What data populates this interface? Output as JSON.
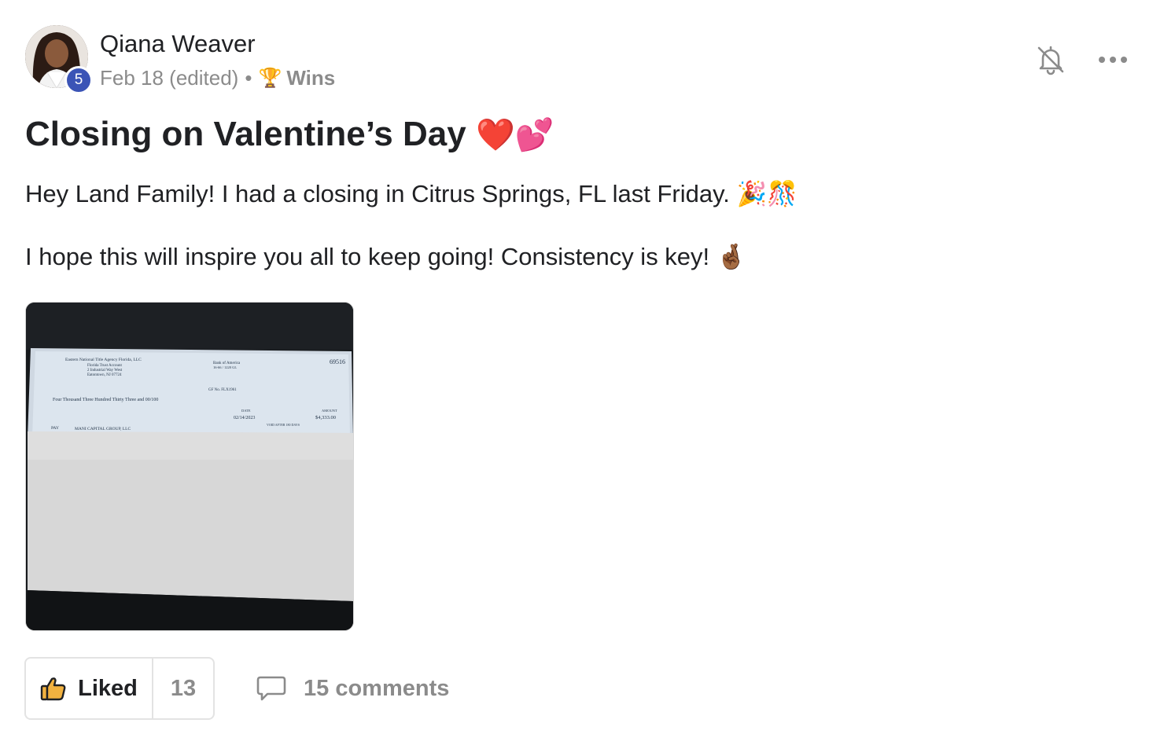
{
  "author": {
    "name": "Qiana Weaver",
    "level": "5",
    "avatar_icon": "profile-photo"
  },
  "meta": {
    "date": "Feb 18 (edited)",
    "separator": "•",
    "category_icon": "🏆",
    "category": "Wins"
  },
  "actions": {
    "notify_icon": "bell-off-icon",
    "more_icon": "more-horizontal-icon"
  },
  "post": {
    "title": "Closing on Valentine’s Day",
    "title_emoji": "❤️💕",
    "paragraph1": "Hey Land Family! I had a closing in Citrus Springs, FL last Friday. 🎉🎊",
    "paragraph2": "I hope this will inspire you all to keep going! Consistency is key! 🤞🏾"
  },
  "check": {
    "payer_line1": "Eastern National Title Agency Florida, LLC",
    "payer_line2": "Florida Trust Account",
    "payer_line3": "2 Industrial Way West",
    "payer_line4": "Eatontown, NJ 07724",
    "bank_line1": "Bank of America",
    "bank_line2": "16-66 / 1220 GL",
    "check_number": "69516",
    "gf_no": "GF No.   FLX1961",
    "amount_words": "Four Thousand Three Hundred Thirty Three and 00/100",
    "date_label": "DATE",
    "date": "02/14/2023",
    "amount_label": "AMOUNT",
    "amount": "$4,333.00",
    "void_text": "VOID AFTER 180 DAYS",
    "pay_label": "PAY",
    "payee": "MANI CAPITAL GROUP, LLC"
  },
  "footer": {
    "like_label": "Liked",
    "like_count": "13",
    "comments_label": "15 comments",
    "colors": {
      "muted": "#8b8b8b",
      "badge": "#3b54b6",
      "like_icon": "#f2b240"
    }
  }
}
